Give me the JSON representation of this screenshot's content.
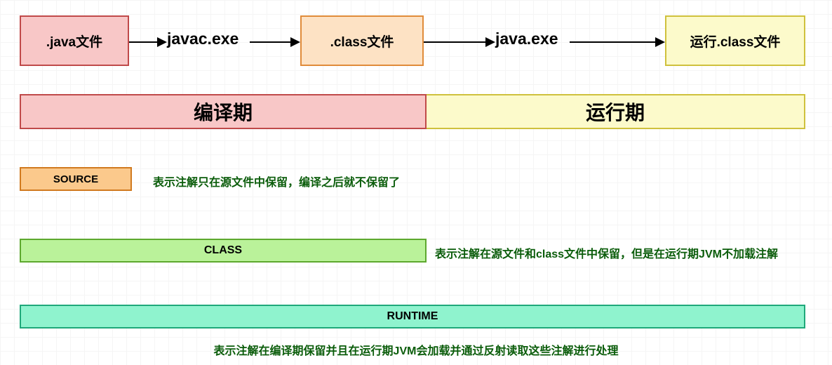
{
  "flow": {
    "java_file": ".java文件",
    "javac_label": "javac.exe",
    "class_file": ".class文件",
    "java_label": "java.exe",
    "run_class": "运行.class文件"
  },
  "phases": {
    "compile": "编译期",
    "run": "运行期"
  },
  "retention": {
    "source": {
      "label": "SOURCE",
      "desc": "表示注解只在源文件中保留，编译之后就不保留了"
    },
    "class": {
      "label": "CLASS",
      "desc": "表示注解在源文件和class文件中保留，但是在运行期JVM不加载注解"
    },
    "runtime": {
      "label": "RUNTIME",
      "desc": "表示注解在编译期保留并且在运行期JVM会加载并通过反射读取这些注解进行处理"
    }
  }
}
